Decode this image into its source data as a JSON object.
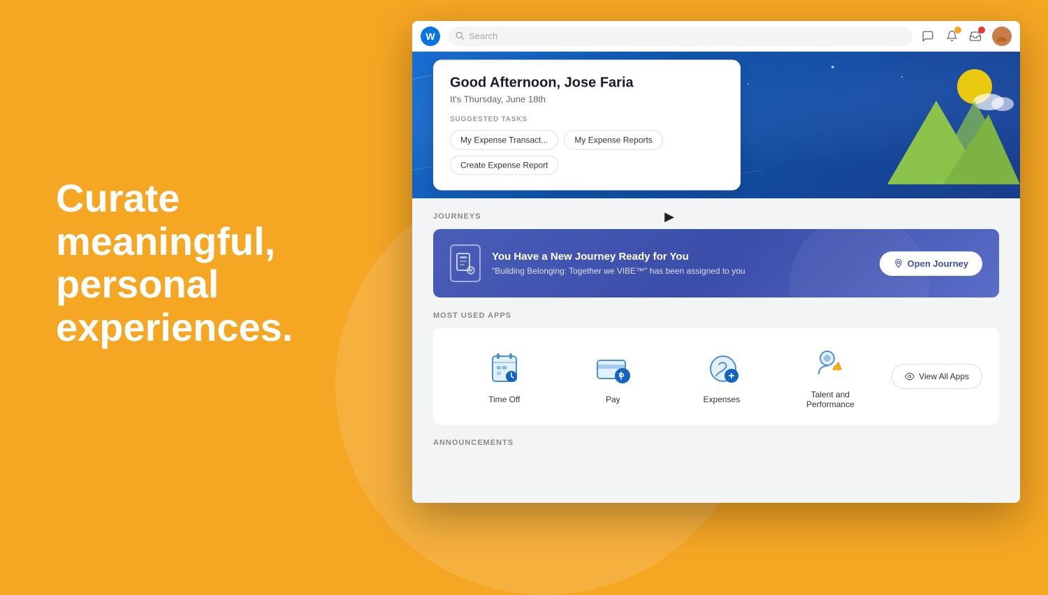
{
  "page": {
    "background_color": "#F5A623"
  },
  "left_panel": {
    "headline": "Curate meaningful, personal experiences."
  },
  "browser": {
    "logo_letter": "W",
    "search_placeholder": "Search",
    "toolbar_icons": {
      "chat": "💬",
      "bell": "🔔",
      "inbox": "📋",
      "avatar": "👤"
    }
  },
  "hero": {
    "greeting": "Good Afternoon, Jose Faria",
    "date": "It's Thursday, June 18th",
    "suggested_tasks_label": "SUGGESTED TASKS",
    "task_buttons": [
      "My Expense Transact...",
      "My Expense Reports",
      "Create Expense Report"
    ]
  },
  "journeys": {
    "section_label": "JOURNEYS",
    "card_title": "You Have a New Journey Ready for You",
    "card_subtitle": "\"Building Belonging: Together we VIBE™\" has been assigned to you",
    "button_label": "Open Journey"
  },
  "most_used_apps": {
    "section_label": "MOST USED APPS",
    "apps": [
      {
        "name": "Time Off",
        "icon": "time-off"
      },
      {
        "name": "Pay",
        "icon": "pay"
      },
      {
        "name": "Expenses",
        "icon": "expenses"
      },
      {
        "name": "Talent and\nPerformance",
        "icon": "talent"
      }
    ],
    "view_all_label": "View All Apps"
  },
  "announcements": {
    "section_label": "ANNOUNCEMENTS"
  }
}
